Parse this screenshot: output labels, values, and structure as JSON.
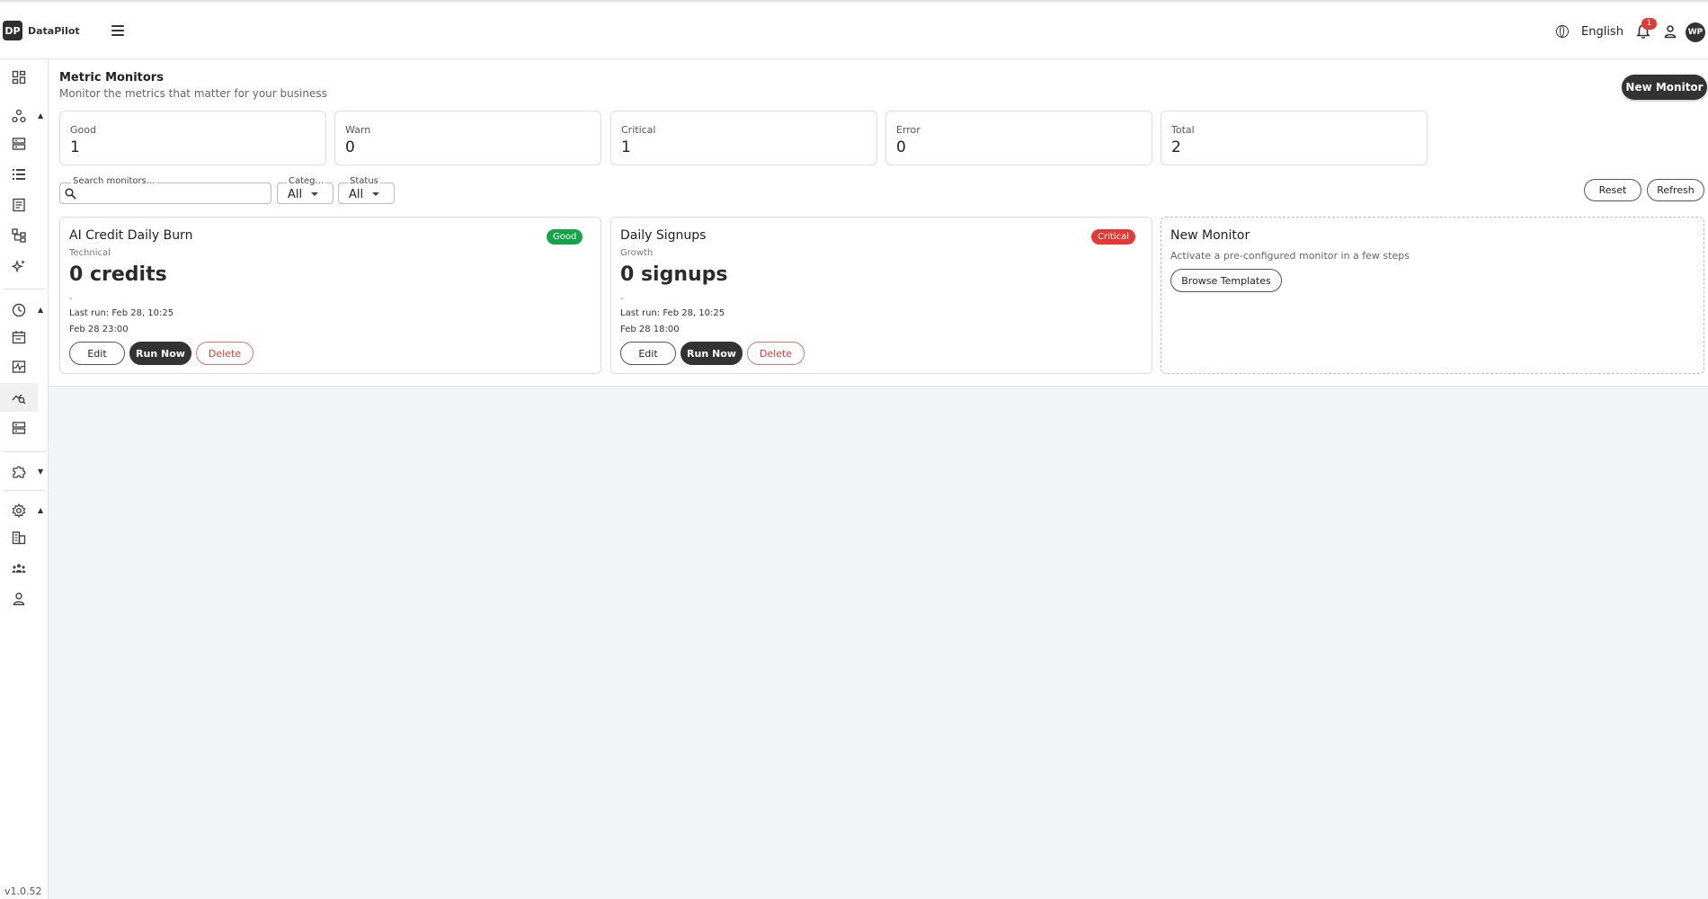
{
  "app": {
    "brand_mark": "DP",
    "brand_name": "DataPilot",
    "language": "English",
    "notification_count": "1",
    "avatar_initials": "WP",
    "version": "v1.0.52"
  },
  "sidebar": {
    "items": [
      {
        "icon": "dashboard-icon"
      },
      {
        "icon": "connections-icon"
      },
      {
        "icon": "database-icon"
      },
      {
        "icon": "list-icon"
      },
      {
        "icon": "document-icon"
      },
      {
        "icon": "workflow-icon"
      },
      {
        "icon": "sparkles-icon"
      },
      {
        "icon": "clock-icon"
      },
      {
        "icon": "calendar-icon"
      },
      {
        "icon": "activity-icon"
      },
      {
        "icon": "metric-monitor-icon"
      },
      {
        "icon": "server-icon"
      },
      {
        "icon": "puzzle-icon"
      },
      {
        "icon": "settings-icon"
      },
      {
        "icon": "organization-icon"
      },
      {
        "icon": "team-icon"
      },
      {
        "icon": "user-icon"
      }
    ]
  },
  "page": {
    "title": "Metric Monitors",
    "subtitle": "Monitor the metrics that matter for your business",
    "new_monitor_label": "New Monitor"
  },
  "stats": [
    {
      "label": "Good",
      "value": "1"
    },
    {
      "label": "Warn",
      "value": "0"
    },
    {
      "label": "Critical",
      "value": "1"
    },
    {
      "label": "Error",
      "value": "0"
    },
    {
      "label": "Total",
      "value": "2"
    }
  ],
  "filters": {
    "search_label": "Search monitors...",
    "category_label": "Categ...",
    "category_value": "All",
    "status_label": "Status",
    "status_value": "All",
    "reset_label": "Reset",
    "refresh_label": "Refresh"
  },
  "monitors": [
    {
      "name": "AI Credit Daily Burn",
      "category": "Technical",
      "value": "0 credits",
      "dash": "-",
      "last_run": "Last run: Feb 28, 10:25",
      "next_run": "Feb 28 23:00",
      "status": "Good",
      "edit_label": "Edit",
      "run_label": "Run Now",
      "delete_label": "Delete"
    },
    {
      "name": "Daily Signups",
      "category": "Growth",
      "value": "0 signups",
      "dash": "-",
      "last_run": "Last run: Feb 28, 10:25",
      "next_run": "Feb 28 18:00",
      "status": "Critical",
      "edit_label": "Edit",
      "run_label": "Run Now",
      "delete_label": "Delete"
    }
  ],
  "template_card": {
    "title": "New Monitor",
    "description": "Activate a pre-configured monitor in a few steps",
    "button_label": "Browse Templates"
  },
  "colors": {
    "good": "#16a34a",
    "critical": "#e53935",
    "primary": "#333333"
  }
}
